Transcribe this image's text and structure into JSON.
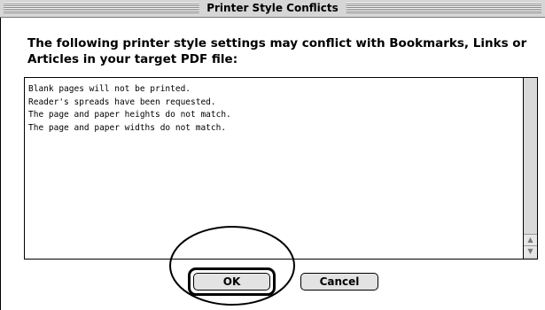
{
  "dialog": {
    "title": "Printer Style Conflicts",
    "message": "The following printer style settings may conflict with Bookmarks, Links or Articles in your target PDF file:"
  },
  "conflicts": [
    "Blank pages will not be printed.",
    "Reader's spreads have been requested.",
    "The page and paper heights do not match.",
    "The page and paper widths do not match."
  ],
  "buttons": {
    "ok_label": "OK",
    "cancel_label": "Cancel",
    "default": "OK"
  },
  "icons": {
    "scroll_up": "scroll-up-arrow-icon",
    "scroll_down": "scroll-down-arrow-icon"
  },
  "colors": {
    "titlebar": "#d6d6d6",
    "button_face": "#e3e3e3",
    "annotation": "#000000"
  }
}
